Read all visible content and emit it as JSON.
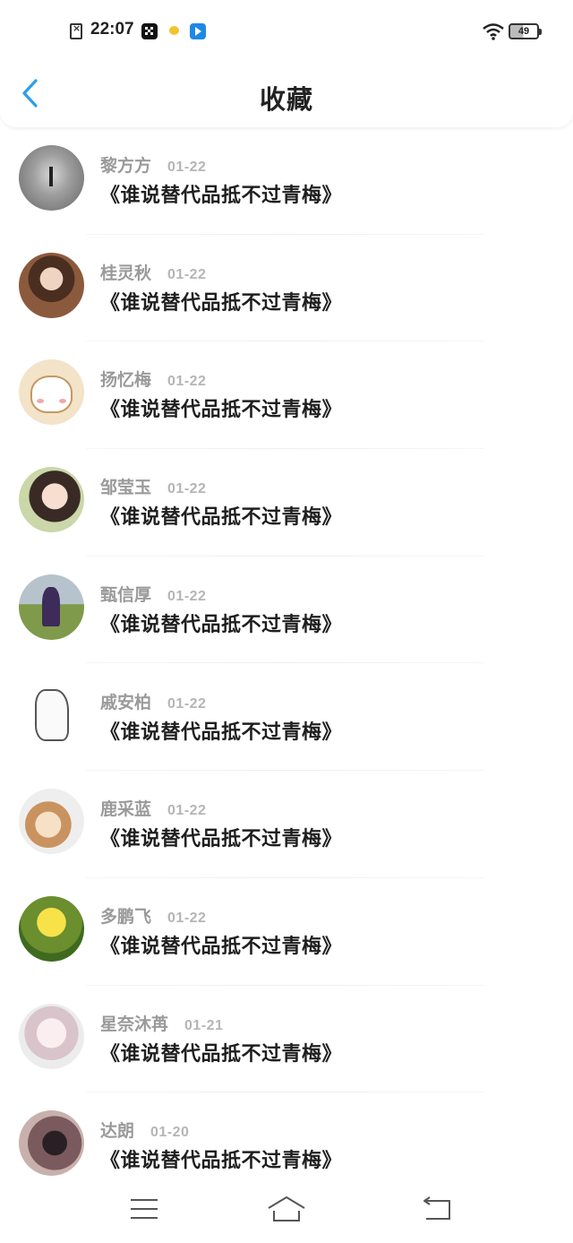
{
  "status_bar": {
    "time": "22:07",
    "battery": "49",
    "icons": [
      "sim-missing-icon",
      "app-icon",
      "notification-icon",
      "app-icon",
      "wifi-icon",
      "battery-icon"
    ]
  },
  "header": {
    "title": "收藏",
    "back_icon": "chevron-left-icon",
    "accent_color": "#2a9fe8"
  },
  "favorites": [
    {
      "name": "黎方方",
      "date": "01-22",
      "title": "《谁说替代品抵不过青梅》"
    },
    {
      "name": "桂灵秋",
      "date": "01-22",
      "title": "《谁说替代品抵不过青梅》"
    },
    {
      "name": "扬忆梅",
      "date": "01-22",
      "title": "《谁说替代品抵不过青梅》"
    },
    {
      "name": "邹莹玉",
      "date": "01-22",
      "title": "《谁说替代品抵不过青梅》"
    },
    {
      "name": "甄信厚",
      "date": "01-22",
      "title": "《谁说替代品抵不过青梅》"
    },
    {
      "name": "戚安柏",
      "date": "01-22",
      "title": "《谁说替代品抵不过青梅》"
    },
    {
      "name": "鹿采蓝",
      "date": "01-22",
      "title": "《谁说替代品抵不过青梅》"
    },
    {
      "name": "多鹏飞",
      "date": "01-22",
      "title": "《谁说替代品抵不过青梅》"
    },
    {
      "name": "星奈沐苒",
      "date": "01-21",
      "title": "《谁说替代品抵不过青梅》"
    },
    {
      "name": "达朗",
      "date": "01-20",
      "title": "《谁说替代品抵不过青梅》"
    }
  ],
  "nav_bar": {
    "icons": [
      "menu-icon",
      "home-icon",
      "back-icon"
    ]
  }
}
